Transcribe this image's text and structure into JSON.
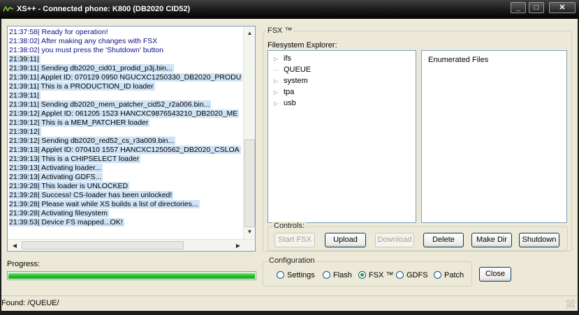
{
  "window": {
    "title": "XS++ - Connected phone: K800 (DB2020 CID52)",
    "min_icon": "_",
    "max_icon": "□",
    "close_icon": "✕"
  },
  "log": [
    {
      "text": "21:37:58| Ready for operation!",
      "style": "blue"
    },
    {
      "text": "21:38:02| After making any changes with FSX",
      "style": "blue"
    },
    {
      "text": "21:38:02| you must press the 'Shutdown' button",
      "style": "blue"
    },
    {
      "text": "21:39:11|",
      "style": "hl"
    },
    {
      "text": "21:39:11| Sending db2020_cid01_prodid_p3j.bin...",
      "style": "hl"
    },
    {
      "text": "21:39:11| Applet ID: 070129 0950 NGUCXC1250330_DB2020_PRODU",
      "style": "hl"
    },
    {
      "text": "21:39:11| This is a PRODUCTION_ID loader",
      "style": "hl"
    },
    {
      "text": "21:39:11|",
      "style": "hl"
    },
    {
      "text": "21:39:11| Sending db2020_mem_patcher_cid52_r2a006.bin...",
      "style": "hl"
    },
    {
      "text": "21:39:12| Applet ID: 061205 1523 HANCXC9876543210_DB2020_ME",
      "style": "hl"
    },
    {
      "text": "21:39:12| This is a MEM_PATCHER loader",
      "style": "hl"
    },
    {
      "text": "21:39:12|",
      "style": "hl"
    },
    {
      "text": "21:39:12| Sending db2020_red52_cs_r3a009.bin...",
      "style": "hl"
    },
    {
      "text": "21:39:13| Applet ID: 070410 1557 HANCXC1250562_DB2020_CSLOA",
      "style": "hl"
    },
    {
      "text": "21:39:13| This is a CHIPSELECT loader",
      "style": "hl"
    },
    {
      "text": "21:39:13| Activating loader...",
      "style": "hl"
    },
    {
      "text": "21:39:13| Activating GDFS...",
      "style": "hl"
    },
    {
      "text": "21:39:28| This loader is UNLOCKED",
      "style": "hl"
    },
    {
      "text": "21:39:28| Success! CS-loader has been unlocked!",
      "style": "hl"
    },
    {
      "text": "21:39:28| Please wait while XS builds a list of directories...",
      "style": "hl"
    },
    {
      "text": "21:39:28| Activating filesystem",
      "style": "hl"
    },
    {
      "text": "21:39:53| Device FS mapped...OK!",
      "style": "hl"
    }
  ],
  "scroll": {
    "up": "▲",
    "down": "▼",
    "left": "◀",
    "right": "▶"
  },
  "progress": {
    "label": "Progress:",
    "value": 1.0
  },
  "fsx": {
    "group_title": "FSX ™",
    "explorer_label": "Filesystem Explorer:",
    "tree": [
      {
        "label": "ifs",
        "expandable": true
      },
      {
        "label": "QUEUE",
        "expandable": false
      },
      {
        "label": "system",
        "expandable": true
      },
      {
        "label": "tpa",
        "expandable": true
      },
      {
        "label": "usb",
        "expandable": true
      }
    ],
    "expander_glyph": "▷",
    "leaf_glyph": "···",
    "files_header": "Enumerated Files"
  },
  "controls": {
    "title": "Controls:",
    "start_fsx": "Start FSX",
    "upload": "Upload",
    "download": "Download",
    "delete": "Delete",
    "make_dir": "Make Dir",
    "shutdown": "Shutdown"
  },
  "configuration": {
    "title": "Configuration",
    "options": [
      "Settings",
      "Flash",
      "FSX ™",
      "GDFS",
      "Patch"
    ],
    "selected": "FSX ™"
  },
  "close_button": "Close",
  "status": "Found: /QUEUE/"
}
